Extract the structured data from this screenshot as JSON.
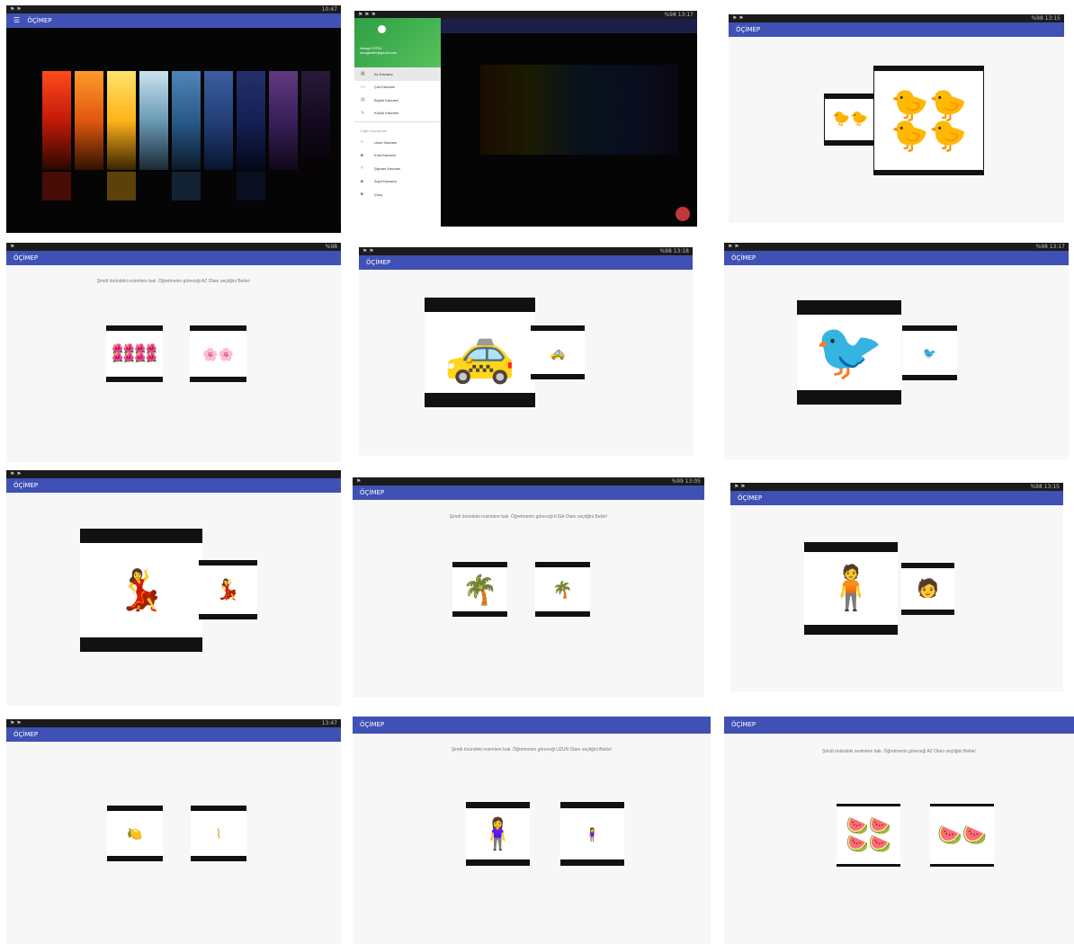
{
  "app": {
    "title": "ÖÇİMEP"
  },
  "status": {
    "p1": "10:47",
    "p2": "%98 13:17",
    "p3": "%98 13:15",
    "p4": "%98",
    "p5": "%98 13:18",
    "p6": "%98 13:17",
    "p8": "%99 13:05",
    "p9": "%98 13:15",
    "p10": "13:47"
  },
  "drawer": {
    "user_name": "Ninagtı SİTİN",
    "user_email": "ninagtisitin@gmail.com",
    "items": [
      {
        "icon": "grid-icon",
        "label": "Az Kavramı"
      },
      {
        "icon": "tablet-icon",
        "label": "Çok Kavramı"
      },
      {
        "icon": "book-icon",
        "label": "Büyük Kavramı"
      },
      {
        "icon": "pencil-icon",
        "label": "Küçük Kavramı"
      }
    ],
    "section_label": "Diğer Kavramlar",
    "sub_items": [
      {
        "icon": "share-icon",
        "label": "Uzun Kavramı"
      },
      {
        "icon": "play-icon",
        "label": "Kısa Kavramı"
      },
      {
        "icon": "share-icon",
        "label": "Şişman Kavramı"
      },
      {
        "icon": "play-icon",
        "label": "Zayıf Kavramı"
      },
      {
        "icon": "play-icon",
        "label": "Çıkış"
      }
    ]
  },
  "instructions": {
    "p4": "Şimdi önündeki resimlere bak. Öğretmenin göreceği AZ Olanı seçtiğini Bekle!",
    "p8": "Şimdi önündeki resimlere bak. Öğretmenin göreceği KISA Olanı seçtiğini Bekle!",
    "p11": "Şimdi önündeki resimlere bak. Öğretmenin göreceği UZUN Olanı seçtiğini Bekle!",
    "p12": "Şimdi önündeki resimlere bak. Öğretmenin göreceği AZ Olanı seçtiğini Bekle!"
  },
  "cards": {
    "p3_small": "birds-two",
    "p3_large": "birds-four",
    "p4_left": "flowers-many",
    "p4_right": "flowers-two",
    "p5_big": "car-big",
    "p5_small": "car-small",
    "p6_big": "bird-big",
    "p6_small": "bird-small",
    "p7_big": "girl-big",
    "p7_small": "girl-small",
    "p8_left": "palm-long",
    "p8_right": "palm-short",
    "p9_left": "man-thin",
    "p9_right": "man-fat",
    "p10_left": "fruit",
    "p10_right": "stem",
    "p11_left": "girl-tall",
    "p11_right": "girl-short",
    "p12_left": "watermelon-four",
    "p12_right": "watermelon-two"
  },
  "colors": {
    "appbar": "#3f51b5",
    "drawer_header": "#2e9f45",
    "fab": "#c2363a"
  }
}
